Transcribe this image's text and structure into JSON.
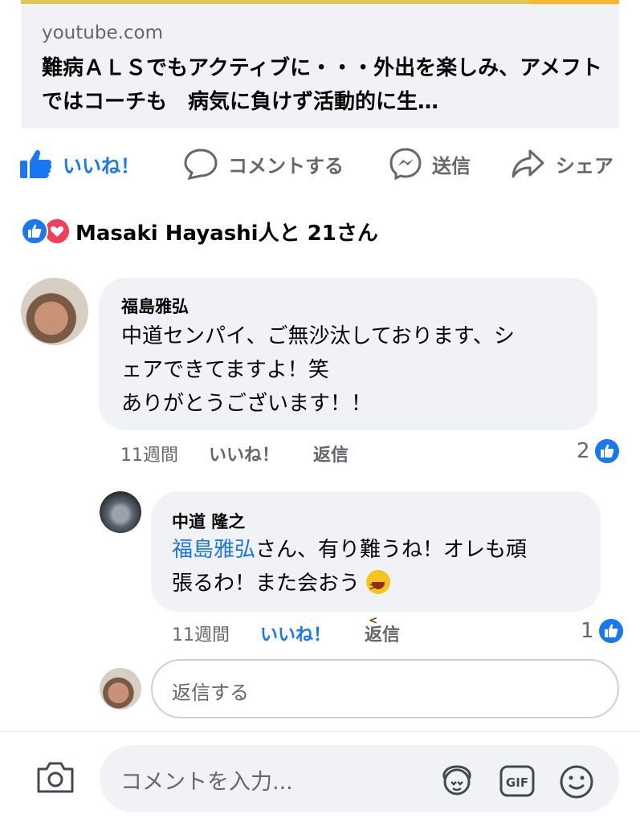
{
  "link_preview": {
    "domain": "youtube.com",
    "title": "難病ＡＬＳでもアクティブに・・・外出を楽しみ、アメフトではコーチも　病気に負けず活動的に生…"
  },
  "actions": {
    "like": "いいね！",
    "comment": "コメントする",
    "send": "送信",
    "share": "シェア"
  },
  "reactions": {
    "summary": "Masaki Hayashi人と 21さん"
  },
  "comments": [
    {
      "author": "福島雅弘",
      "body_lines": [
        "中道センパイ、ご無沙汰しております、シ",
        "ェアできてますよ！笑",
        "ありがとうございます！！"
      ],
      "time": "11週間",
      "like_label": "いいね！",
      "reply_label": "返信",
      "like_count": "2"
    }
  ],
  "reply": {
    "author": "中道 隆之",
    "mention": "福島雅弘",
    "body_rest_line1": "さん、有り難うね！オレも頑",
    "body_line2": "張るわ！また会おう",
    "emoji": "laughing-face",
    "time": "11週間",
    "like_label": "いいね！",
    "reply_label": "返信",
    "like_count": "1"
  },
  "reply_input": {
    "placeholder": "返信する"
  },
  "composer": {
    "placeholder": "コメントを入力..."
  },
  "colors": {
    "accent": "#1877f2",
    "secondary_text": "#65676b",
    "bubble": "#f0f2f5"
  }
}
